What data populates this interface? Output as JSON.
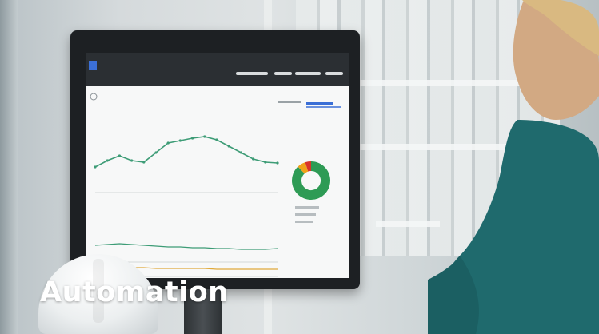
{
  "caption": {
    "title": "Automation"
  },
  "colors": {
    "caption": "#ffffff",
    "sweater": "#1f6a6d",
    "donut_green": "#2e9b55",
    "donut_orange": "#f0a21a",
    "donut_red": "#d9342b",
    "line_main": "#3d9c76",
    "line_lower": "#3d9c76",
    "line_base": "#e0a93a",
    "logo_blue": "#3b6fd6"
  },
  "screen_chart": {
    "main_series": [
      22,
      30,
      36,
      30,
      28,
      40,
      52,
      55,
      58,
      60,
      56,
      48,
      40,
      32,
      28,
      27
    ],
    "lower_series": [
      14,
      15,
      16,
      15,
      14,
      13,
      12,
      12,
      11,
      11,
      10,
      10,
      9,
      9,
      9,
      10
    ],
    "base_series": [
      6,
      6,
      5,
      5,
      5,
      4,
      4,
      4,
      4,
      4,
      3,
      3,
      3,
      3,
      3,
      3
    ],
    "donut": [
      {
        "part": "green",
        "value": 88
      },
      {
        "part": "orange",
        "value": 7
      },
      {
        "part": "red",
        "value": 5
      }
    ]
  },
  "icons": {
    "logo": "abb-logo-icon",
    "menu": "menu-icon",
    "gear": "gear-icon"
  }
}
